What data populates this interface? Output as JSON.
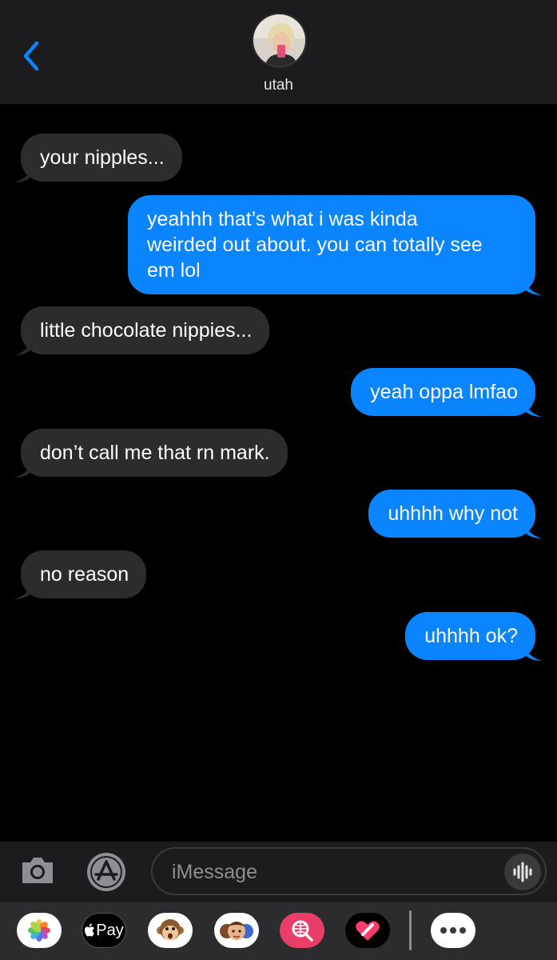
{
  "header": {
    "contact_name": "utah"
  },
  "messages": [
    {
      "direction": "in",
      "text": "your nipples..."
    },
    {
      "direction": "out",
      "lines": [
        "yeahhh that’s what i was kinda",
        "weirded out about. you can totally see",
        "em lol"
      ]
    },
    {
      "direction": "in",
      "text": "little chocolate nippies..."
    },
    {
      "direction": "out",
      "text": "yeah oppa lmfao"
    },
    {
      "direction": "in",
      "text": "don’t call me that rn mark."
    },
    {
      "direction": "out",
      "text": "uhhhh why not"
    },
    {
      "direction": "in",
      "text": "no reason"
    },
    {
      "direction": "out",
      "text": "uhhhh ok?"
    }
  ],
  "composer": {
    "placeholder": "iMessage"
  },
  "app_drawer": {
    "apple_pay_label": "Pay",
    "items": [
      "photos-app-icon",
      "apple-pay-icon",
      "animoji-icon",
      "memoji-stickers-icon",
      "web-images-search-icon",
      "digital-touch-icon",
      "more-apps-icon"
    ]
  },
  "colors": {
    "outgoing_bubble": "#0a84ff",
    "incoming_bubble": "#2c2c2e",
    "accent": "#0a84ff"
  }
}
